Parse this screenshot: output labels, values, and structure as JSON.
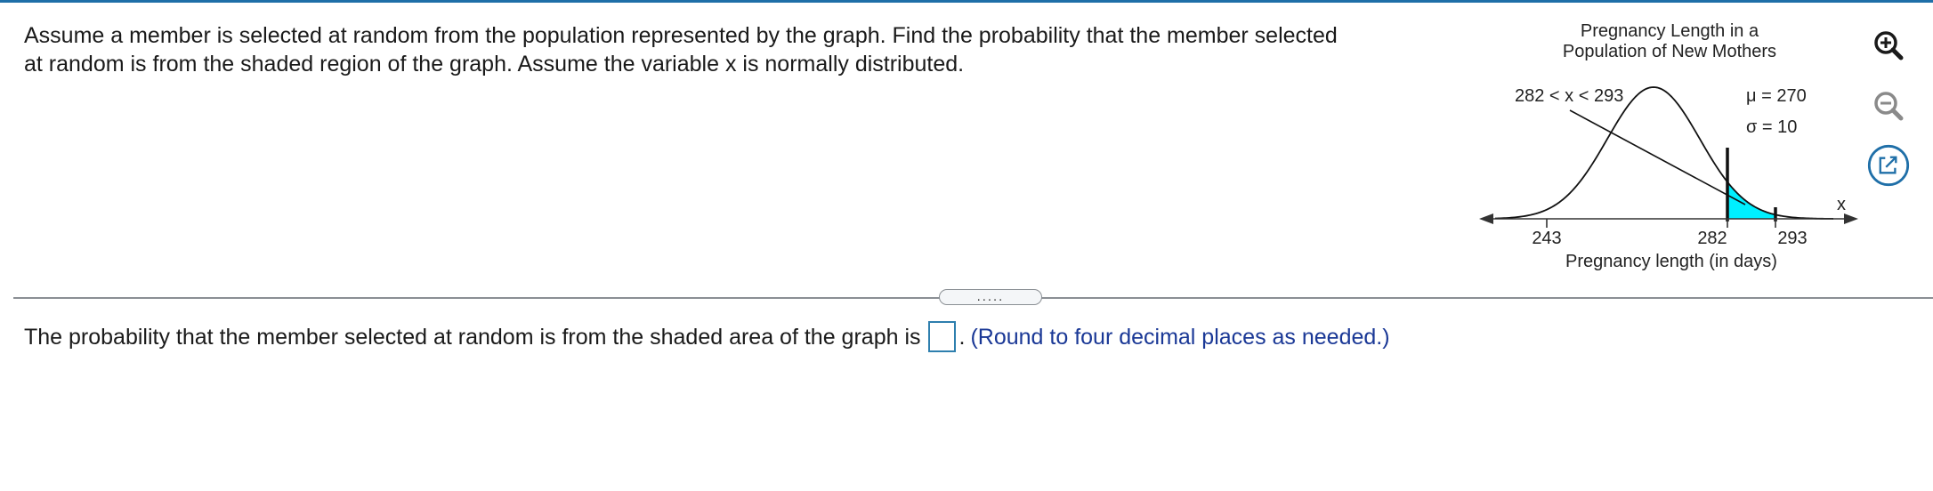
{
  "question": {
    "line1": "Assume a member is selected at random from the population represented by the graph. Find the probability that the member selected",
    "line2": "at random is from the shaded region of the graph. Assume the variable x is normally distributed."
  },
  "figure": {
    "title_line1": "Pregnancy Length in a",
    "title_line2": "Population of New Mothers",
    "region_label": "282 < x < 293",
    "mu_label": "μ = 270",
    "sigma_label": "σ = 10",
    "x_var": "x",
    "ticks": [
      "243",
      "282",
      "293"
    ],
    "xlabel": "Pregnancy length (in days)",
    "fill_color": "#00f0ff"
  },
  "divider": {
    "handle": "....."
  },
  "answer": {
    "prompt": "The probability that the member selected at random is from the shaded area of the graph is",
    "suffix": ".",
    "hint": "(Round to four decimal places as needed.)"
  },
  "tools": [
    "zoom-in-icon",
    "zoom-out-icon",
    "popout-icon"
  ]
}
